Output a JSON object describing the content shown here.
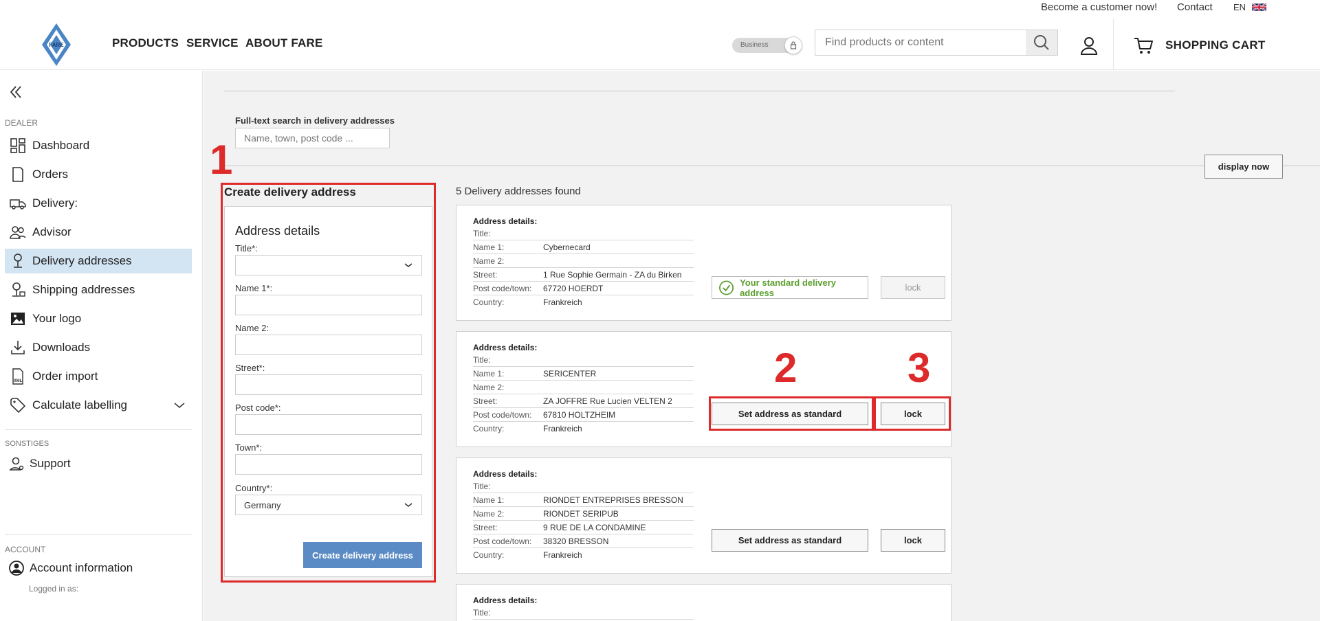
{
  "topbar": {
    "become_customer": "Become a customer now!",
    "contact": "Contact",
    "language": "EN"
  },
  "header": {
    "logo_text": "FARE",
    "nav": [
      "PRODUCTS",
      "SERVICE",
      "ABOUT FARE"
    ],
    "business_toggle_label": "Business",
    "search_placeholder": "Find products or content",
    "cart_label": "SHOPPING CART"
  },
  "sidebar": {
    "section_dealer": "DEALER",
    "items": [
      {
        "label": "Dashboard",
        "icon": "dashboard-icon"
      },
      {
        "label": "Orders",
        "icon": "orders-icon"
      },
      {
        "label": "Delivery:",
        "icon": "truck-icon"
      },
      {
        "label": "Advisor",
        "icon": "people-icon"
      },
      {
        "label": "Delivery addresses",
        "icon": "location-pin-icon",
        "active": true
      },
      {
        "label": "Shipping addresses",
        "icon": "shipping-pin-icon"
      },
      {
        "label": "Your logo",
        "icon": "image-icon"
      },
      {
        "label": "Downloads",
        "icon": "download-icon"
      },
      {
        "label": "Order import",
        "icon": "xml-file-icon"
      },
      {
        "label": "Calculate labelling",
        "icon": "tag-icon",
        "expandable": true
      }
    ],
    "section_other": "SONSTIGES",
    "support": "Support",
    "section_account": "ACCOUNT",
    "account_info": "Account information",
    "logged_in_as": "Logged in as:"
  },
  "main": {
    "fulltext_label": "Full-text search in delivery addresses",
    "fulltext_placeholder": "Name, town, post code ...",
    "display_now": "display now",
    "found_text": "5 Delivery addresses found"
  },
  "annotations": [
    "1",
    "2",
    "3"
  ],
  "create_form": {
    "title": "Create delivery address",
    "section": "Address details",
    "fields": {
      "title": "Title*:",
      "name1": "Name 1*:",
      "name2": "Name 2:",
      "street": "Street*:",
      "postcode": "Post code*:",
      "town": "Town*:",
      "country": "Country*:"
    },
    "country_value": "Germany",
    "submit": "Create delivery address"
  },
  "row_labels": {
    "header": "Address details:",
    "title": "Title:",
    "name1": "Name 1:",
    "name2": "Name 2:",
    "street": "Street:",
    "postcode_town": "Post code/town:",
    "country": "Country:"
  },
  "addresses": [
    {
      "title": "",
      "name1": "Cybernecard",
      "name2": "",
      "street": "1 Rue Sophie Germain - ZA du Birken",
      "postcode_town": "67720 HOERDT",
      "country": "Frankreich",
      "is_standard": true,
      "standard_label": "Your standard delivery address",
      "lock_label": "lock"
    },
    {
      "title": "",
      "name1": "SERICENTER",
      "name2": "",
      "street": "ZA JOFFRE Rue Lucien VELTEN 2",
      "postcode_town": "67810 HOLTZHEIM",
      "country": "Frankreich",
      "is_standard": false,
      "set_label": "Set address as standard",
      "lock_label": "lock"
    },
    {
      "title": "",
      "name1": "RIONDET ENTREPRISES BRESSON",
      "name2": "RIONDET SERIPUB",
      "street": "9 RUE DE LA CONDAMINE",
      "postcode_town": "38320 BRESSON",
      "country": "Frankreich",
      "is_standard": false,
      "set_label": "Set address as standard",
      "lock_label": "lock"
    },
    {
      "title": ""
    }
  ],
  "colors": {
    "accent_blue": "#5b8bc4",
    "active_nav_bg": "#d3e4f3",
    "standard_green": "#5a9e2e",
    "annotation_red": "#dd2a2a"
  }
}
